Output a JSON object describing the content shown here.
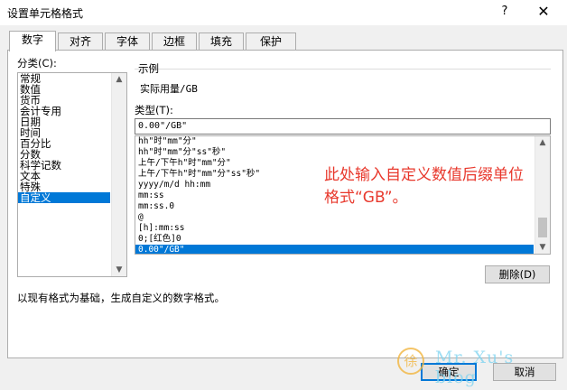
{
  "window": {
    "title": "设置单元格格式",
    "help": "?",
    "close": "✕"
  },
  "tabs": [
    {
      "label": "数字",
      "active": true
    },
    {
      "label": "对齐"
    },
    {
      "label": "字体"
    },
    {
      "label": "边框"
    },
    {
      "label": "填充"
    },
    {
      "label": "保护"
    }
  ],
  "category": {
    "label": "分类(C):",
    "items": [
      "常规",
      "数值",
      "货币",
      "会计专用",
      "日期",
      "时间",
      "百分比",
      "分数",
      "科学记数",
      "文本",
      "特殊",
      "自定义"
    ],
    "selected_index": 11
  },
  "sample": {
    "label": "示例",
    "value": "实际用量/GB"
  },
  "type": {
    "label": "类型(T):",
    "value": "0.00\"/GB\"",
    "items": [
      "hh\"时\"mm\"分\"",
      "hh\"时\"mm\"分\"ss\"秒\"",
      "上午/下午h\"时\"mm\"分\"",
      "上午/下午h\"时\"mm\"分\"ss\"秒\"",
      "yyyy/m/d hh:mm",
      "mm:ss",
      "mm:ss.0",
      "@",
      "[h]:mm:ss",
      "0;[红色]0",
      "0.00\"/GB\""
    ],
    "selected_index": 10
  },
  "annotation": {
    "line1": "此处输入自定义数值后缀单位",
    "line2": "格式“GB”。"
  },
  "buttons": {
    "delete": "删除(D)",
    "ok": "确定",
    "cancel": "取消"
  },
  "description": "以现有格式为基础，生成自定义的数字格式。",
  "watermark": {
    "text": "Mr. Xu's blog",
    "glyph": "徐"
  }
}
